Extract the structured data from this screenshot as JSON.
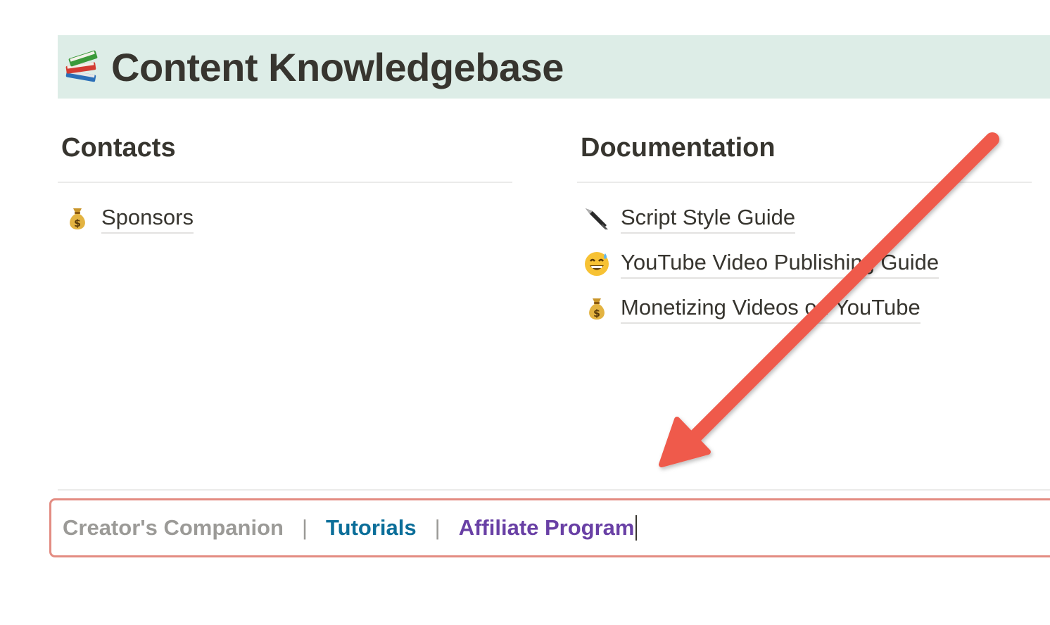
{
  "page": {
    "title": "Content Knowledgebase",
    "title_icon": "books-icon",
    "title_bg_color": "#ddede7"
  },
  "columns": [
    {
      "heading": "Contacts",
      "links": [
        {
          "label": "Sponsors",
          "icon": "money-bag-icon"
        }
      ]
    },
    {
      "heading": "Documentation",
      "links": [
        {
          "label": "Script Style Guide",
          "icon": "fountain-pen-icon"
        },
        {
          "label": "YouTube Video Publishing Guide",
          "icon": "grinning-sweat-face-icon"
        },
        {
          "label": "Monetizing Videos on YouTube",
          "icon": "money-bag-icon"
        }
      ]
    }
  ],
  "footer": {
    "items": [
      {
        "label": "Creator's Companion",
        "color": "#9b9a97"
      },
      {
        "label": "Tutorials",
        "color": "#0b6e99"
      },
      {
        "label": "Affiliate Program",
        "color": "#6940a5"
      }
    ],
    "separator": "|",
    "highlight_border_color": "#e38c82"
  },
  "annotation": {
    "arrow_color": "#ef5a4c",
    "arrow_icon": "red-arrow-icon"
  }
}
